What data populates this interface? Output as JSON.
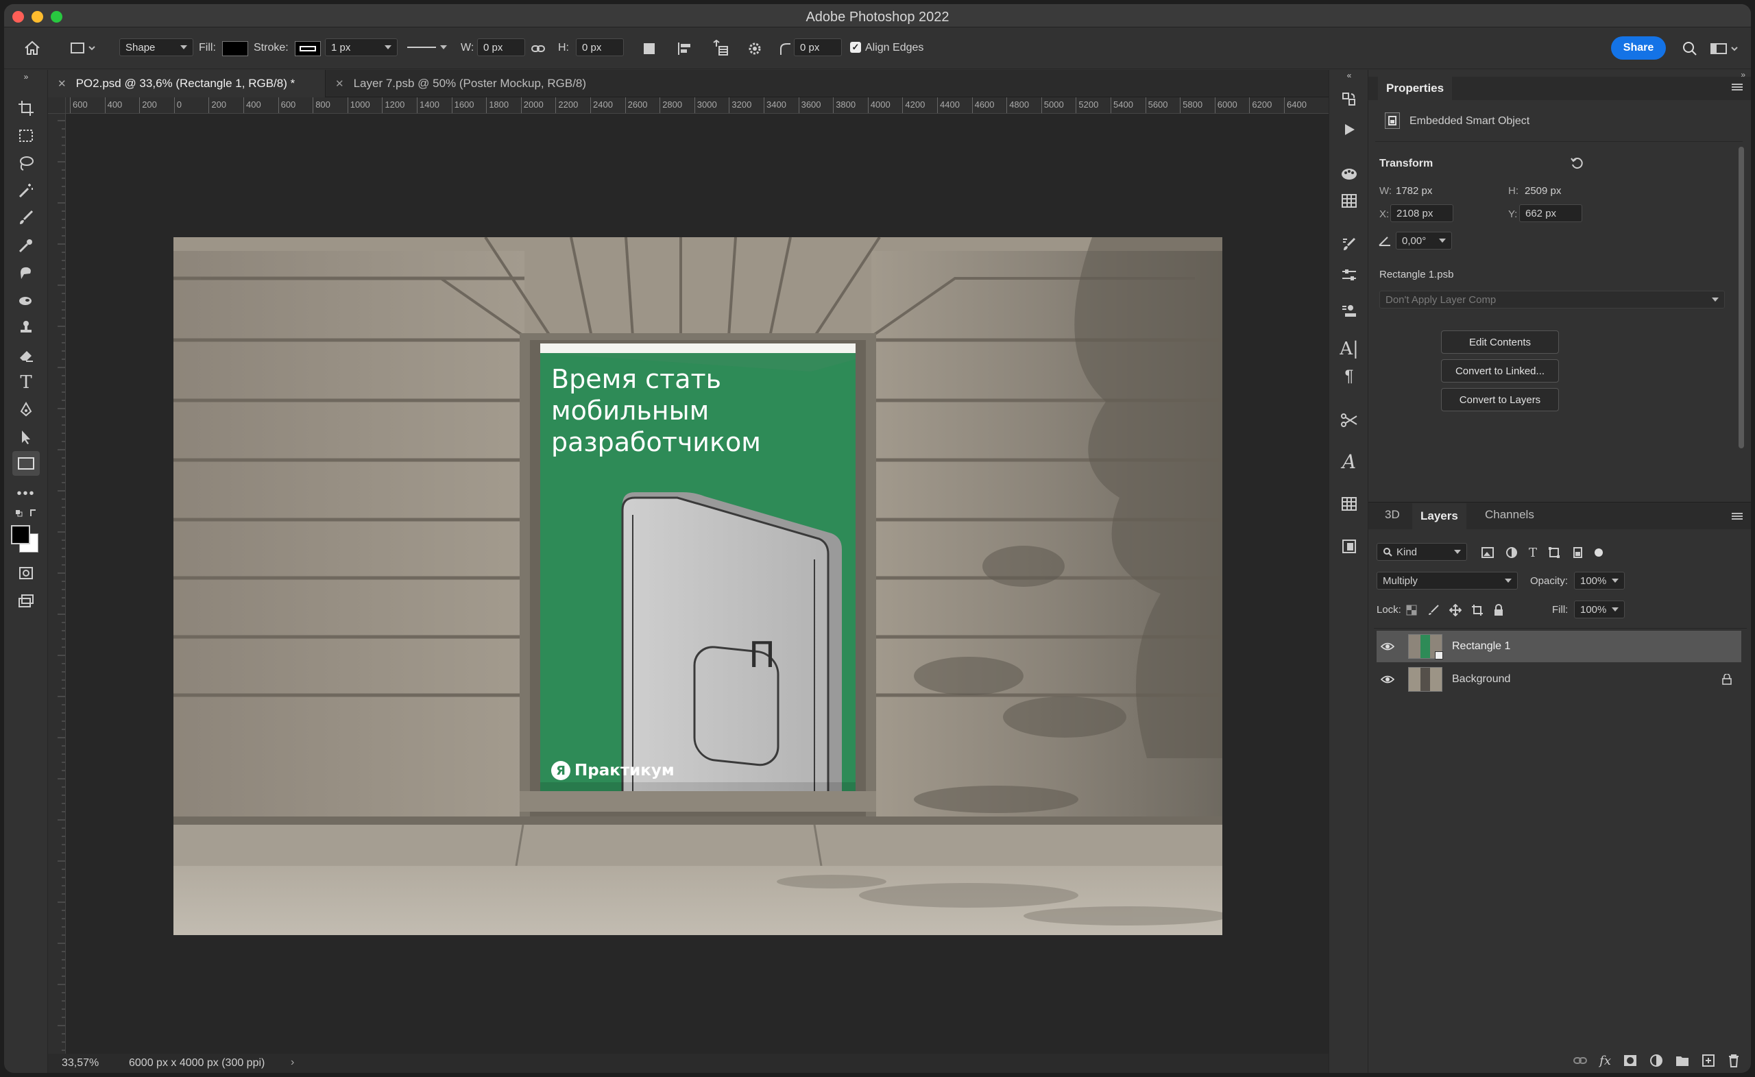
{
  "app": {
    "title": "Adobe Photoshop 2022"
  },
  "options_bar": {
    "mode": "Shape",
    "fill_label": "Fill:",
    "stroke_label": "Stroke:",
    "stroke_width": "1 px",
    "w_label": "W:",
    "w_value": "0 px",
    "h_label": "H:",
    "h_value": "0 px",
    "radius_value": "0 px",
    "align_edges": "Align Edges",
    "share": "Share"
  },
  "tabs": [
    {
      "label": "PO2.psd @ 33,6% (Rectangle 1, RGB/8) *",
      "active": true
    },
    {
      "label": "Layer 7.psb @ 50% (Poster Mockup, RGB/8)",
      "active": false
    }
  ],
  "ruler_h": [
    "600",
    "400",
    "200",
    "0",
    "200",
    "400",
    "600",
    "800",
    "1000",
    "1200",
    "1400",
    "1600",
    "1800",
    "2000",
    "2200",
    "2400",
    "2600",
    "2800",
    "3000",
    "3200",
    "3400",
    "3600",
    "3800",
    "4000",
    "4200",
    "4400",
    "4600",
    "4800",
    "5000",
    "5200",
    "5400",
    "5600",
    "5800",
    "6000",
    "6200",
    "6400"
  ],
  "poster": {
    "headline": [
      "Время стать",
      "мобильным",
      "разработчиком"
    ],
    "brand": "Практикум",
    "brand_mark": "Я",
    "card_mark": "П",
    "color": "#2e8b57"
  },
  "status": {
    "zoom": "33,57%",
    "doc_info": "6000 px x 4000 px (300 ppi)"
  },
  "properties": {
    "title": "Properties",
    "object_type": "Embedded Smart Object",
    "transform": "Transform",
    "w_label": "W:",
    "w_value": "1782 px",
    "h_label": "H:",
    "h_value": "2509 px",
    "x_label": "X:",
    "x_value": "2108 px",
    "y_label": "Y:",
    "y_value": "662 px",
    "angle_value": "0,00°",
    "file_name": "Rectangle 1.psb",
    "layer_comp": "Don't Apply Layer Comp",
    "edit_contents": "Edit Contents",
    "convert_linked": "Convert to Linked...",
    "convert_layers": "Convert to Layers"
  },
  "layers_panel": {
    "tabs": [
      "3D",
      "Layers",
      "Channels"
    ],
    "filter_kind": "Kind",
    "blend_mode": "Multiply",
    "opacity_label": "Opacity:",
    "opacity_value": "100%",
    "lock_label": "Lock:",
    "fill_label": "Fill:",
    "fill_value": "100%",
    "layers": [
      {
        "name": "Rectangle 1",
        "selected": true,
        "locked": false
      },
      {
        "name": "Background",
        "selected": false,
        "locked": true
      }
    ]
  }
}
